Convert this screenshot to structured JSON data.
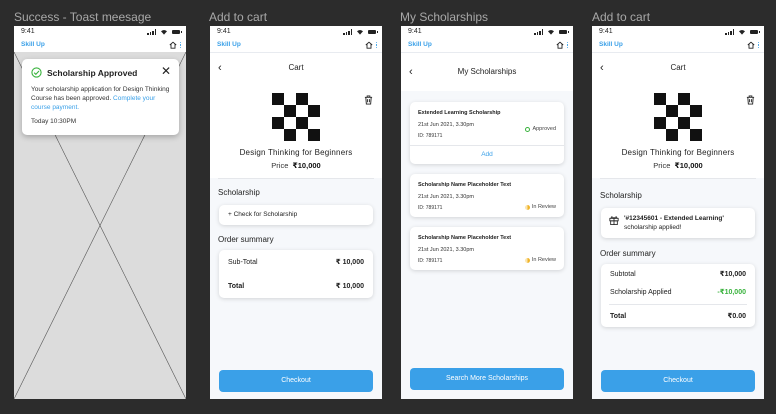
{
  "frames": [
    {
      "title": "Success - Toast meesage"
    },
    {
      "title": "Add to cart"
    },
    {
      "title": "My Scholarships"
    },
    {
      "title": "Add to cart"
    }
  ],
  "status_bar": {
    "time": "9:41"
  },
  "app": {
    "name": "Skill Up"
  },
  "toast": {
    "title": "Scholarship Approved",
    "body": "Your scholarship application for Design Thinking Course has been approved.",
    "link": "Complete your course payment.",
    "time": "Today 10:30PM"
  },
  "cart": {
    "header": "Cart",
    "course_title": "Design Thinking for Beginners",
    "price_label": "Price",
    "price": "₹10,000",
    "scholarship_label": "Scholarship",
    "check_button": "+ Check for Scholarship",
    "order_summary_label": "Order summary",
    "subtotal_label": "Sub-Total",
    "subtotal": "₹ 10,000",
    "total_label": "Total",
    "total": "₹ 10,000",
    "checkout": "Checkout"
  },
  "scholarships": {
    "header": "My Scholarships",
    "items": [
      {
        "title": "Extended Learning Scholarship",
        "date": "21st Jun 2021, 3.30pm",
        "id": "ID: 789171",
        "status": "Approved"
      },
      {
        "title": "Scholarship Name Placeholder Text",
        "date": "21st Jun 2021, 3.30pm",
        "id": "ID: 789171",
        "status": "In Review"
      },
      {
        "title": "Scholarship Name Placeholder Text",
        "date": "21st Jun 2021, 3.30pm",
        "id": "ID: 789171",
        "status": "In Review"
      }
    ],
    "add_label": "Add",
    "search_button": "Search More Scholarships"
  },
  "cart_applied": {
    "header": "Cart",
    "course_title": "Design Thinking for Beginners",
    "price_label": "Price",
    "price": "₹10,000",
    "scholarship_label": "Scholarship",
    "applied_code": "'#12345601 - Extended Learning'",
    "applied_text": "scholarship applied!",
    "order_summary_label": "Order summary",
    "subtotal_label": "Subtotal",
    "subtotal": "₹10,000",
    "applied_label": "Scholarship Applied",
    "applied_value": "-₹10,000",
    "total_label": "Total",
    "total": "₹0.00",
    "checkout": "Checkout"
  },
  "colors": {
    "accent": "#3aa0e8",
    "success": "#38b23c",
    "review": "#f0b429",
    "canvas": "#2c2c2c"
  }
}
